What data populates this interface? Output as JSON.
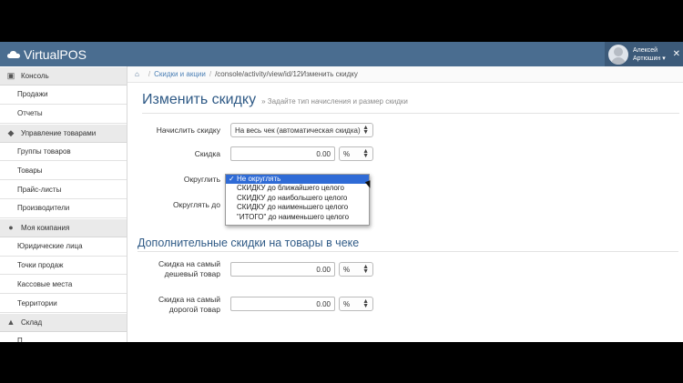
{
  "app": {
    "name": "VirtualPOS"
  },
  "user": {
    "name": "Алексей",
    "surname": "Артюшин"
  },
  "sidebar": {
    "sections": [
      {
        "label": "Консоль",
        "icon": "dashboard-icon",
        "items": [
          "Продажи",
          "Отчеты"
        ]
      },
      {
        "label": "Управление товарами",
        "icon": "cubes-icon",
        "items": [
          "Группы товаров",
          "Товары",
          "Прайс-листы",
          "Производители"
        ]
      },
      {
        "label": "Моя компания",
        "icon": "users-icon",
        "items": [
          "Юридические лица",
          "Точки продаж",
          "Кассовые места",
          "Территории"
        ]
      },
      {
        "label": "Склад",
        "icon": "warehouse-icon",
        "items": [
          "П..."
        ]
      }
    ]
  },
  "breadcrumb": {
    "home_icon": "home-icon",
    "link": "Скидки и акции",
    "current": "/console/activity/view/id/12Изменить скидку"
  },
  "page": {
    "title": "Изменить скидку",
    "subtitle": "» Задайте тип начисления и размер скидки"
  },
  "form": {
    "charge": {
      "label": "Начислить скидку",
      "value": "На весь чек (автоматическая скидка)"
    },
    "discount": {
      "label": "Скидка",
      "value": "0.00",
      "unit": "%"
    },
    "round": {
      "label": "Округлить"
    },
    "round_to": {
      "label": "Округлять до"
    }
  },
  "dropdown": {
    "options": [
      "Не округлять",
      "СКИДКУ до ближайшего целого",
      "СКИДКУ до наибольшего целого",
      "СКИДКУ до наименьшего целого",
      "\"ИТОГО\" до наименьшего целого"
    ],
    "selected_index": 0
  },
  "section2": {
    "title": "Дополнительные скидки на товары в чеке",
    "cheap": {
      "label1": "Скидка на самый",
      "label2": "дешевый товар",
      "value": "0.00",
      "unit": "%"
    },
    "expensive": {
      "label1": "Скидка на самый",
      "label2": "дорогой товар",
      "value": "0.00",
      "unit": "%"
    }
  },
  "colors": {
    "topbar": "#4a6d90",
    "accent": "#2f5a86",
    "selection": "#2f6bd6"
  }
}
